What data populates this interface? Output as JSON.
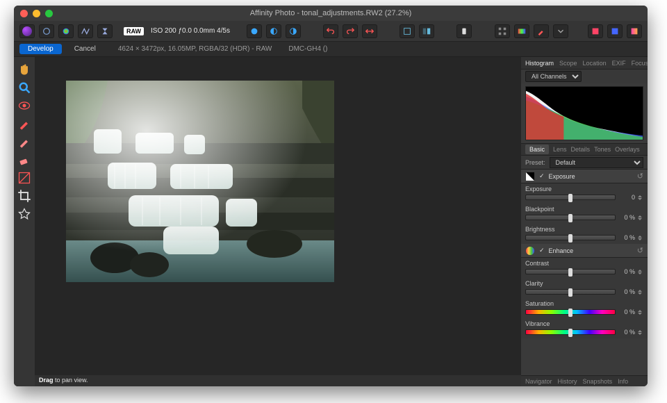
{
  "window": {
    "title": "Affinity Photo - tonal_adjustments.RW2 (27.2%)"
  },
  "toolbar": {
    "raw_badge": "RAW",
    "raw_info": "ISO 200 ƒ0.0 0.0mm 4/5s"
  },
  "subbar": {
    "develop": "Develop",
    "cancel": "Cancel",
    "dim": "4624 × 3472px, 16.05MP, RGBA/32 (HDR) - RAW",
    "camera": "DMC-GH4 ()"
  },
  "side_tabs": {
    "top": [
      "Histogram",
      "Scope",
      "Location",
      "EXIF",
      "Focus"
    ],
    "active_top": "Histogram"
  },
  "histogram": {
    "channels_label": "All Channels"
  },
  "subtabs": {
    "items": [
      "Basic",
      "Lens",
      "Details",
      "Tones",
      "Overlays"
    ],
    "active": "Basic"
  },
  "preset": {
    "label": "Preset:",
    "value": "Default"
  },
  "sections": {
    "exposure": {
      "title": "Exposure",
      "sliders": [
        {
          "label": "Exposure",
          "value": "0",
          "pos": 50,
          "rainbow": false
        },
        {
          "label": "Blackpoint",
          "value": "0 %",
          "pos": 50,
          "rainbow": false
        },
        {
          "label": "Brightness",
          "value": "0 %",
          "pos": 50,
          "rainbow": false
        }
      ]
    },
    "enhance": {
      "title": "Enhance",
      "sliders": [
        {
          "label": "Contrast",
          "value": "0 %",
          "pos": 50,
          "rainbow": false
        },
        {
          "label": "Clarity",
          "value": "0 %",
          "pos": 50,
          "rainbow": false
        },
        {
          "label": "Saturation",
          "value": "0 %",
          "pos": 50,
          "rainbow": true
        },
        {
          "label": "Vibrance",
          "value": "0 %",
          "pos": 50,
          "rainbow": true
        }
      ]
    }
  },
  "bottom_tabs": [
    "Navigator",
    "History",
    "Snapshots",
    "Info"
  ],
  "status": {
    "strong": "Drag",
    "rest": " to pan view."
  }
}
